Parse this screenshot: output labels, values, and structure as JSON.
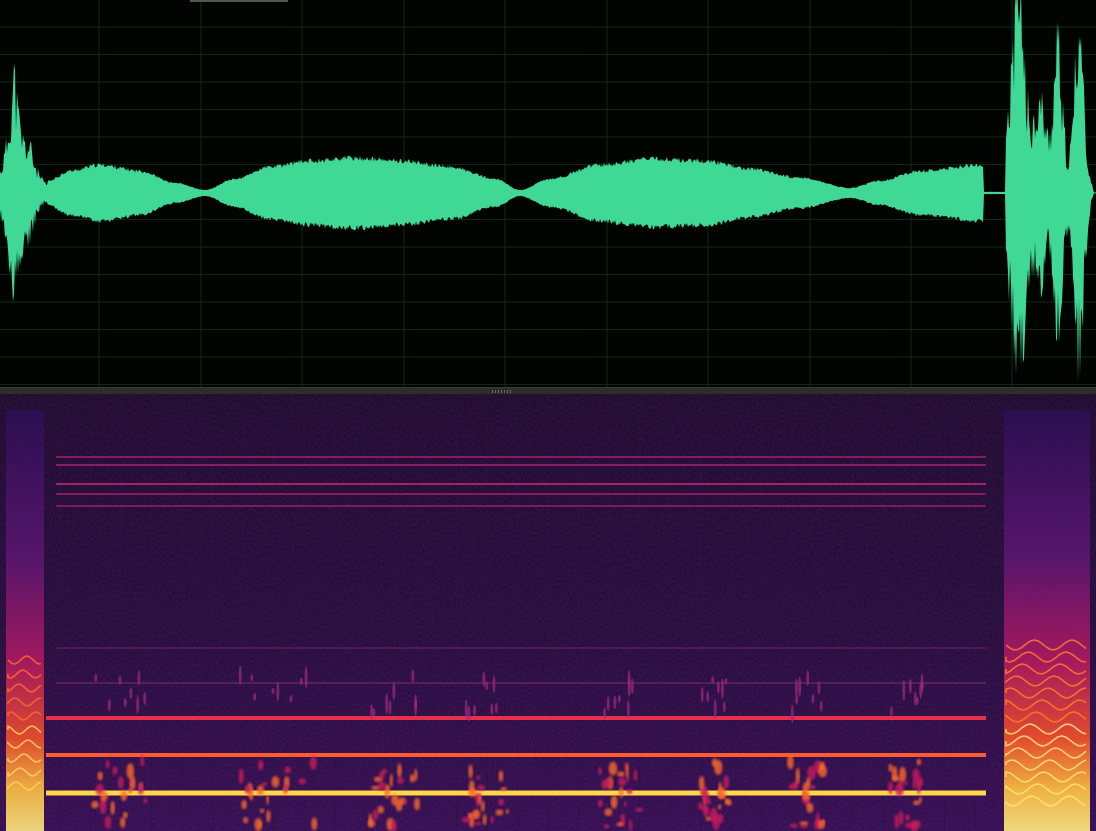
{
  "view": {
    "waveform": {
      "color": "#40d895",
      "grid_color": "#0c2a12",
      "background": "#020402"
    },
    "spectrogram": {
      "colormap": "magma",
      "background": "#160a28",
      "low_color": "#2c0f52",
      "mid_color": "#c0185f",
      "high_color": "#ffd54a"
    },
    "splitter_color": "#2d2d2d"
  }
}
